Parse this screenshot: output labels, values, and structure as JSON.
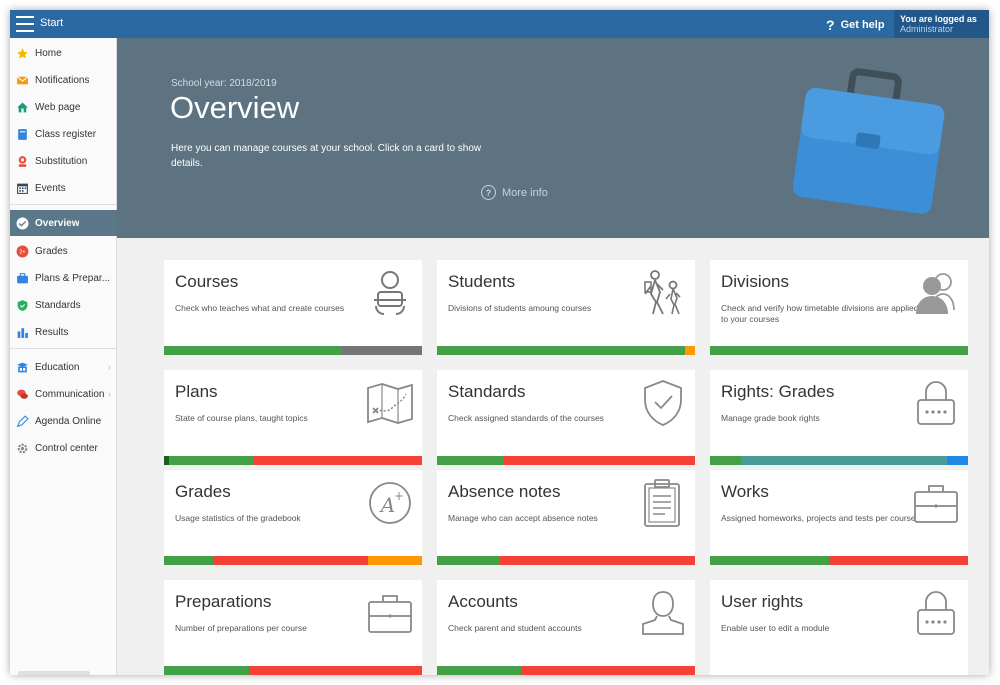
{
  "topbar": {
    "start_label": "Start",
    "help_label": "Get help",
    "help_icon": "?",
    "login_line1": "You are logged as",
    "login_line2": "Administrator"
  },
  "sidebar": {
    "items": [
      {
        "label": "Home",
        "icon": "star-icon"
      },
      {
        "label": "Notifications",
        "icon": "envelope-icon"
      },
      {
        "label": "Web page",
        "icon": "house-icon"
      },
      {
        "label": "Class register",
        "icon": "book-icon"
      },
      {
        "label": "Substitution",
        "icon": "person-icon"
      },
      {
        "label": "Events",
        "icon": "calendar-icon"
      },
      {
        "label": "Overview",
        "icon": "checkmark-icon"
      },
      {
        "label": "Grades",
        "icon": "grade-icon"
      },
      {
        "label": "Plans & Prepar...",
        "icon": "briefcase-icon"
      },
      {
        "label": "Standards",
        "icon": "shield-icon"
      },
      {
        "label": "Results",
        "icon": "bar-chart-icon"
      },
      {
        "label": "Education",
        "icon": "education-icon"
      },
      {
        "label": "Communication",
        "icon": "chat-icon"
      },
      {
        "label": "Agenda Online",
        "icon": "pen-icon"
      },
      {
        "label": "Control center",
        "icon": "gear-icon"
      }
    ]
  },
  "hero": {
    "school_year": "School year: 2018/2019",
    "title": "Overview",
    "description": "Here you can manage courses at your school. Click on a card to show details.",
    "more_info": "More info"
  },
  "cards": [
    {
      "title": "Courses",
      "desc": "Check who teaches what and create courses",
      "icon": "teacher-desk-icon",
      "bar": [
        {
          "pct": 69,
          "color": "#43a047"
        },
        {
          "pct": 31,
          "color": "#757575"
        }
      ]
    },
    {
      "title": "Students",
      "desc": "Divisions of students amoung courses",
      "icon": "walking-students-icon",
      "bar": [
        {
          "pct": 96,
          "color": "#43a047"
        },
        {
          "pct": 4,
          "color": "#ff9800"
        }
      ]
    },
    {
      "title": "Divisions",
      "desc": "Check and verify how timetable divisions are applied to your courses",
      "icon": "users-icon",
      "bar": [
        {
          "pct": 100,
          "color": "#43a047"
        }
      ]
    },
    {
      "title": "Plans",
      "desc": "State of course plans, taught topics",
      "icon": "treasure-map-icon",
      "bar": [
        {
          "pct": 2,
          "color": "#1b5e20"
        },
        {
          "pct": 33,
          "color": "#43a047"
        },
        {
          "pct": 65,
          "color": "#f44336"
        }
      ]
    },
    {
      "title": "Standards",
      "desc": "Check assigned standards of the courses",
      "icon": "shield-check-icon",
      "bar": [
        {
          "pct": 26,
          "color": "#43a047"
        },
        {
          "pct": 74,
          "color": "#f44336"
        }
      ]
    },
    {
      "title": "Rights: Grades",
      "desc": "Manage grade book rights",
      "icon": "padlock-icon",
      "bar": [
        {
          "pct": 12,
          "color": "#43a047"
        },
        {
          "pct": 80,
          "color": "#4a9a9a"
        },
        {
          "pct": 8,
          "color": "#1e88e5"
        }
      ]
    },
    {
      "title": "Grades",
      "desc": "Usage statistics of the gradebook",
      "icon": "a-plus-grade-icon",
      "bar": [
        {
          "pct": 19,
          "color": "#43a047"
        },
        {
          "pct": 60,
          "color": "#f44336"
        },
        {
          "pct": 21,
          "color": "#ff9800"
        }
      ]
    },
    {
      "title": "Absence notes",
      "desc": "Manage who can accept absence notes",
      "icon": "clipboard-icon",
      "bar": [
        {
          "pct": 24,
          "color": "#43a047"
        },
        {
          "pct": 76,
          "color": "#f44336"
        }
      ]
    },
    {
      "title": "Works",
      "desc": "Assigned homeworks, projects and tests per course",
      "icon": "briefcase-outline-icon",
      "bar": [
        {
          "pct": 46,
          "color": "#43a047"
        },
        {
          "pct": 54,
          "color": "#f44336"
        }
      ]
    },
    {
      "title": "Preparations",
      "desc": "Number of preparations per course",
      "icon": "briefcase-outline-icon",
      "bar": [
        {
          "pct": 33,
          "color": "#43a047"
        },
        {
          "pct": 67,
          "color": "#f44336"
        }
      ]
    },
    {
      "title": "Accounts",
      "desc": "Check parent and student accounts",
      "icon": "user-outline-icon",
      "bar": [
        {
          "pct": 33,
          "color": "#43a047"
        },
        {
          "pct": 67,
          "color": "#f44336"
        }
      ]
    },
    {
      "title": "User rights",
      "desc": "Enable user to edit a module",
      "icon": "padlock-icon",
      "bar": []
    }
  ]
}
